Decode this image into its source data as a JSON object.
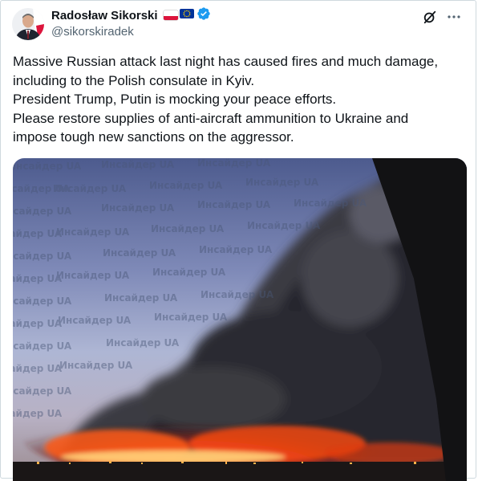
{
  "author": {
    "display_name": "Radosław Sikorski",
    "handle": "@sikorskiradek",
    "badges": [
      "flag-poland",
      "flag-eu",
      "verified-badge"
    ]
  },
  "actions": {
    "grok_icon": "grok-icon",
    "more_icon": "more-icon"
  },
  "tweet": {
    "lines": [
      "Massive Russian attack last night has caused fires and much damage,",
      "including to the Polish consulate in Kyiv.",
      "President Trump, Putin is mocking your peace efforts.",
      "Please restore supplies of anti-aircraft ammunition to Ukraine and",
      "impose tough new sanctions on the aggressor."
    ]
  },
  "media": {
    "watermark_text": "Инсайдер UA",
    "colors": {
      "sky_top": "#4a5a8c",
      "sky_mid": "#aab3d2",
      "fire": "#ff4a12",
      "smoke": "#2b2c33"
    }
  },
  "colors": {
    "text": "#0f1419",
    "secondary": "#536471",
    "verified": "#1d9bf0",
    "border": "#cfd9de"
  }
}
